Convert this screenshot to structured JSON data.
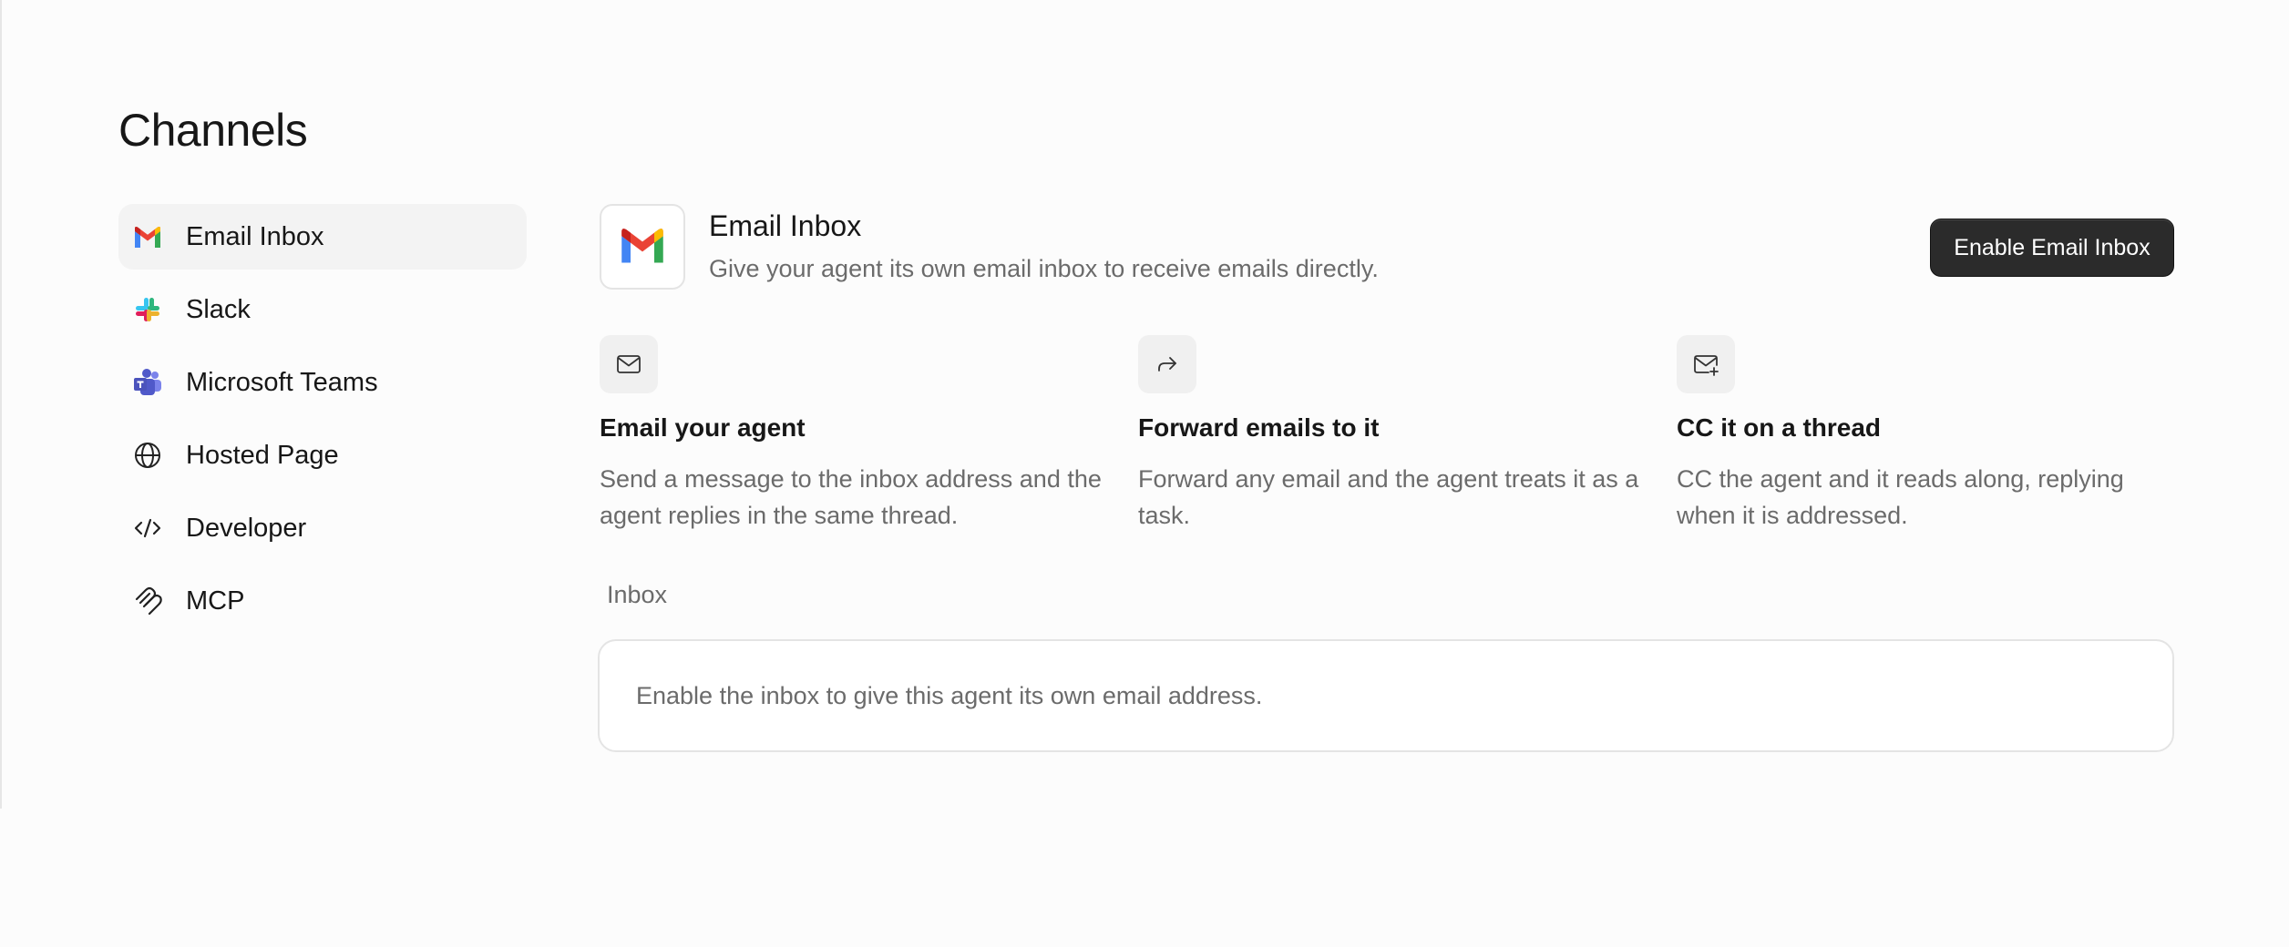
{
  "page": {
    "title": "Channels"
  },
  "sidebar": {
    "items": [
      {
        "label": "Email Inbox",
        "icon": "gmail-icon",
        "active": true
      },
      {
        "label": "Slack",
        "icon": "slack-icon"
      },
      {
        "label": "Microsoft Teams",
        "icon": "teams-icon"
      },
      {
        "label": "Hosted Page",
        "icon": "globe-icon"
      },
      {
        "label": "Developer",
        "icon": "code-icon"
      },
      {
        "label": "MCP",
        "icon": "mcp-icon"
      }
    ]
  },
  "header": {
    "title": "Email Inbox",
    "description": "Give your agent its own email inbox to receive emails directly.",
    "enable_label": "Enable Email Inbox"
  },
  "features": [
    {
      "title": "Email your agent",
      "description": "Send a message to the inbox address and the agent replies in the same thread.",
      "icon": "mail-icon"
    },
    {
      "title": "Forward emails to it",
      "description": "Forward any email and the agent treats it as a task.",
      "icon": "forward-icon"
    },
    {
      "title": "CC it on a thread",
      "description": "CC the agent and it reads along, replying when it is addressed.",
      "icon": "mail-plus-icon"
    }
  ],
  "inbox": {
    "label": "Inbox",
    "empty_text": "Enable the inbox to give this agent its own email address."
  },
  "colors": {
    "background": "#fcfcfc",
    "active_nav": "#f3f3f3",
    "button": "#2b2b2b",
    "muted_text": "#6b6b6b"
  }
}
